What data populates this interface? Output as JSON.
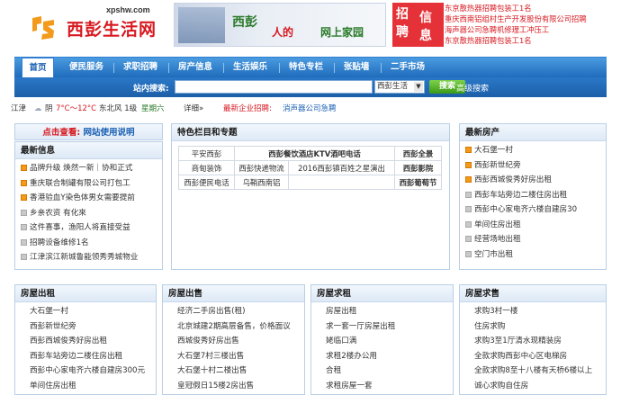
{
  "header": {
    "url": "xpshw.com",
    "site_name": "西彭生活网",
    "banner_line1": "西彭",
    "banner_line2a": "人的",
    "banner_line2b": "网上家园",
    "job_badge_1": "招",
    "job_badge_2": "聘",
    "job_badge_3": "信",
    "job_badge_4": "息",
    "job_ads": [
      "东京散热器招聘包装工1名",
      "重庆西南铝组村生产开发股份有限公司招聘",
      "海声器公司急聘机修理工冲压工",
      "东京散热器招聘包装工1名"
    ]
  },
  "nav": {
    "items": [
      "首页",
      "便民服务",
      "求职招聘",
      "房产信息",
      "生活娱乐",
      "特色专栏",
      "张贴墙",
      "二手市场"
    ]
  },
  "search": {
    "label": "站内搜索:",
    "placeholder": "",
    "scope": "西彭生活",
    "button": "搜索",
    "advanced": "高级搜索"
  },
  "weather": {
    "city": "江津",
    "cond": "阴",
    "temp": "7°C～12°C",
    "wind": "东北风 1级",
    "day": "星期六",
    "detail": "详细»",
    "recruit_label": "最新企业招聘:",
    "recruit_item": "消声器公司急聘"
  },
  "notice": {
    "title": "点击查看:",
    "link": "网站使用说明"
  },
  "latest": {
    "title": "最新信息",
    "items": [
      {
        "text": "品牌升级 焕然一新｜协和正式",
        "hot": true
      },
      {
        "text": "重庆联合制罐有限公司打包工",
        "hot": true
      },
      {
        "text": "香港验血Y染色体男女需要提前",
        "hot": true
      },
      {
        "text": "乡亲农资 有化來",
        "hot": false
      },
      {
        "text": "这件喜事，渔阳人将直接受益",
        "hot": false
      },
      {
        "text": "招聘设备维修1名",
        "hot": false
      },
      {
        "text": "江津滨江新城鲁能领秀秀城物业",
        "hot": false
      }
    ]
  },
  "special": {
    "title": "特色栏目和专题",
    "rows": [
      [
        "平安西彭",
        "西彭餐饮酒店KTV酒吧电话",
        "西彭全景"
      ],
      [
        "商甸装饰",
        "西彭快递物流",
        "2016西彭镇百姓之星演出",
        "西彭影院"
      ],
      [
        "西彭便民电话",
        "乌鞘西南铝",
        "",
        "西彭葡萄节"
      ]
    ]
  },
  "new_house": {
    "title": "最新房产",
    "items": [
      {
        "text": "大石堡一村",
        "hot": true
      },
      {
        "text": "西彭新世纪旁",
        "hot": true
      },
      {
        "text": "西彭西城俊秀好房出租",
        "hot": true
      },
      {
        "text": "西彭车站旁边二楼住房出租",
        "hot": false
      },
      {
        "text": "西彭中心家电齐六楼自建房30",
        "hot": false
      },
      {
        "text": "单间住房出租",
        "hot": false
      },
      {
        "text": "经营场地出租",
        "hot": false
      },
      {
        "text": "空门市出租",
        "hot": false
      }
    ]
  },
  "columns": [
    {
      "title": "房屋出租",
      "items": [
        "大石堡一村",
        "西彭新世纪旁",
        "西彭西城俊秀好房出租",
        "西彭车站旁边二楼住房出租",
        "西彭中心家电齐六楼自建房300元",
        "单间住房出租"
      ]
    },
    {
      "title": "房屋出售",
      "items": [
        "经济二手房出售(租)",
        "北京城建2期高层备售，价格面议",
        "西城俊秀好房出售",
        "大石堡7村三楼出售",
        "大石堡十村二楼出售",
        "皇冠假日15楼2房出售"
      ]
    },
    {
      "title": "房屋求租",
      "items": [
        "房屋出租",
        "求一套一厅房屋出租",
        "姥临口满",
        "求租2楼办公用",
        "合租",
        "求租房屋一套"
      ]
    },
    {
      "title": "房屋求售",
      "items": [
        "求购3村一楼",
        "住房求购",
        "求购3至1厅清水现精装房",
        "全款求购西彭中心区电梯房",
        "全款求购8至十八楼有天桥6楼以上",
        "诚心求购自住房"
      ]
    }
  ],
  "colors": {
    "brand": "#d71920",
    "nav": "#1f6cbc",
    "accent": "#f39a1a",
    "link": "#1a5fb4"
  }
}
